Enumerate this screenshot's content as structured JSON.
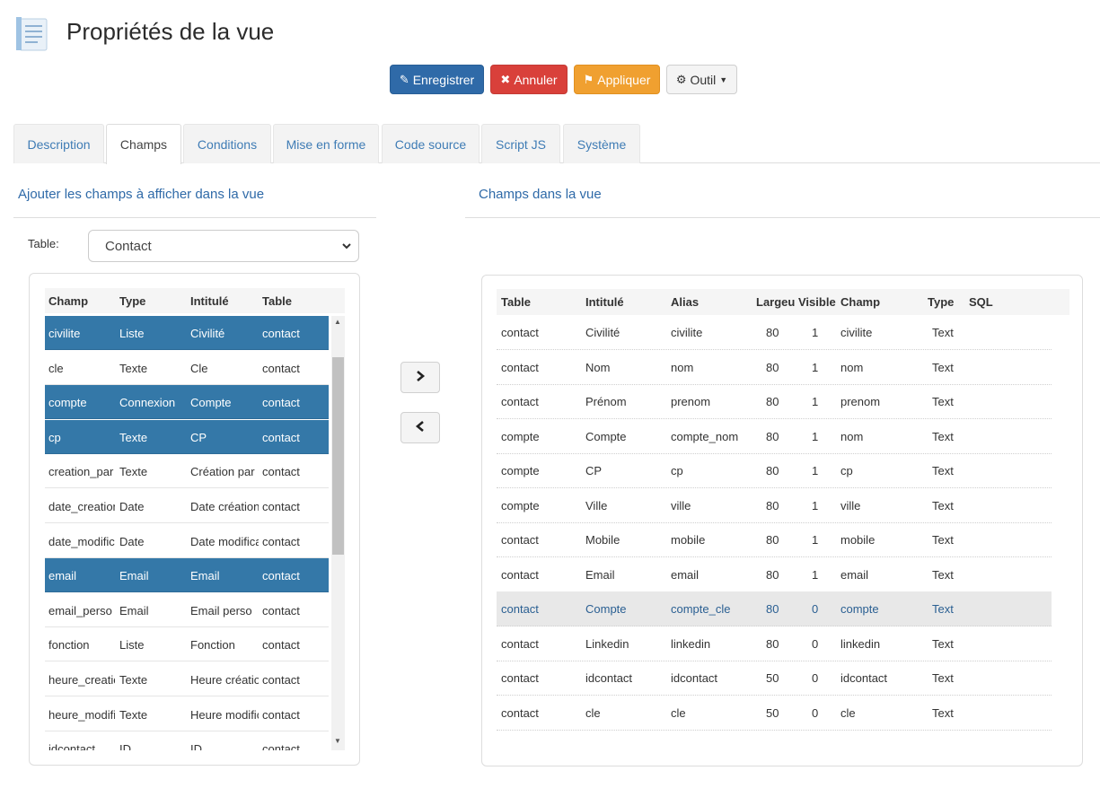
{
  "header": {
    "title": "Propriétés de la vue",
    "icon": "document-icon"
  },
  "toolbar": {
    "save_label": "Enregistrer",
    "cancel_label": "Annuler",
    "apply_label": "Appliquer",
    "tool_label": "Outil",
    "colors": {
      "save": "#2f6aa8",
      "cancel": "#d9403a",
      "apply": "#f0a030"
    }
  },
  "tabs": [
    {
      "label": "Description"
    },
    {
      "label": "Champs",
      "active": true
    },
    {
      "label": "Conditions"
    },
    {
      "label": "Mise en forme"
    },
    {
      "label": "Code source"
    },
    {
      "label": "Script JS"
    },
    {
      "label": "Système"
    }
  ],
  "left": {
    "title": "Ajouter les champs à afficher dans la vue",
    "table_label": "Table:",
    "table_value": "Contact",
    "columns": [
      "Champ",
      "Type",
      "Intitulé",
      "Table"
    ],
    "rows": [
      {
        "champ": "civilite",
        "type": "Liste",
        "intitule": "Civilité",
        "table": "contact",
        "selected": true
      },
      {
        "champ": "cle",
        "type": "Texte",
        "intitule": "Cle",
        "table": "contact",
        "selected": false
      },
      {
        "champ": "compte",
        "type": "Connexion",
        "intitule": "Compte",
        "table": "contact",
        "selected": true
      },
      {
        "champ": "cp",
        "type": "Texte",
        "intitule": "CP",
        "table": "contact",
        "selected": true
      },
      {
        "champ": "creation_par",
        "type": "Texte",
        "intitule": "Création par",
        "table": "contact",
        "selected": false
      },
      {
        "champ": "date_creation",
        "type": "Date",
        "intitule": "Date création",
        "table": "contact",
        "selected": false
      },
      {
        "champ": "date_modification",
        "type": "Date",
        "intitule": "Date modification",
        "table": "contact",
        "selected": false
      },
      {
        "champ": "email",
        "type": "Email",
        "intitule": "Email",
        "table": "contact",
        "selected": true
      },
      {
        "champ": "email_perso",
        "type": "Email",
        "intitule": "Email perso",
        "table": "contact",
        "selected": false
      },
      {
        "champ": "fonction",
        "type": "Liste",
        "intitule": "Fonction",
        "table": "contact",
        "selected": false
      },
      {
        "champ": "heure_creation",
        "type": "Texte",
        "intitule": "Heure création",
        "table": "contact",
        "selected": false
      },
      {
        "champ": "heure_modification",
        "type": "Texte",
        "intitule": "Heure modification",
        "table": "contact",
        "selected": false
      },
      {
        "champ": "idcontact",
        "type": "ID",
        "intitule": "ID",
        "table": "contact",
        "selected": false
      }
    ]
  },
  "move": {
    "add_icon": "chevron-right-icon",
    "remove_icon": "chevron-left-icon"
  },
  "right": {
    "title": "Champs dans la vue",
    "columns": [
      "Table",
      "Intitulé",
      "Alias",
      "Largeu",
      "Visible",
      "Champ",
      "Type",
      "SQL"
    ],
    "rows": [
      {
        "table": "contact",
        "intitule": "Civilité",
        "alias": "civilite",
        "largeur": "80",
        "visible": "1",
        "champ": "civilite",
        "type": "Text",
        "sql": ""
      },
      {
        "table": "contact",
        "intitule": "Nom",
        "alias": "nom",
        "largeur": "80",
        "visible": "1",
        "champ": "nom",
        "type": "Text",
        "sql": ""
      },
      {
        "table": "contact",
        "intitule": "Prénom",
        "alias": "prenom",
        "largeur": "80",
        "visible": "1",
        "champ": "prenom",
        "type": "Text",
        "sql": ""
      },
      {
        "table": "compte",
        "intitule": "Compte",
        "alias": "compte_nom",
        "largeur": "80",
        "visible": "1",
        "champ": "nom",
        "type": "Text",
        "sql": ""
      },
      {
        "table": "compte",
        "intitule": "CP",
        "alias": "cp",
        "largeur": "80",
        "visible": "1",
        "champ": "cp",
        "type": "Text",
        "sql": ""
      },
      {
        "table": "compte",
        "intitule": "Ville",
        "alias": "ville",
        "largeur": "80",
        "visible": "1",
        "champ": "ville",
        "type": "Text",
        "sql": ""
      },
      {
        "table": "contact",
        "intitule": "Mobile",
        "alias": "mobile",
        "largeur": "80",
        "visible": "1",
        "champ": "mobile",
        "type": "Text",
        "sql": ""
      },
      {
        "table": "contact",
        "intitule": "Email",
        "alias": "email",
        "largeur": "80",
        "visible": "1",
        "champ": "email",
        "type": "Text",
        "sql": ""
      },
      {
        "table": "contact",
        "intitule": "Compte",
        "alias": "compte_cle",
        "largeur": "80",
        "visible": "0",
        "champ": "compte",
        "type": "Text",
        "sql": "",
        "highlighted": true
      },
      {
        "table": "contact",
        "intitule": "Linkedin",
        "alias": "linkedin",
        "largeur": "80",
        "visible": "0",
        "champ": "linkedin",
        "type": "Text",
        "sql": ""
      },
      {
        "table": "contact",
        "intitule": "idcontact",
        "alias": "idcontact",
        "largeur": "50",
        "visible": "0",
        "champ": "idcontact",
        "type": "Text",
        "sql": ""
      },
      {
        "table": "contact",
        "intitule": "cle",
        "alias": "cle",
        "largeur": "50",
        "visible": "0",
        "champ": "cle",
        "type": "Text",
        "sql": ""
      }
    ]
  }
}
